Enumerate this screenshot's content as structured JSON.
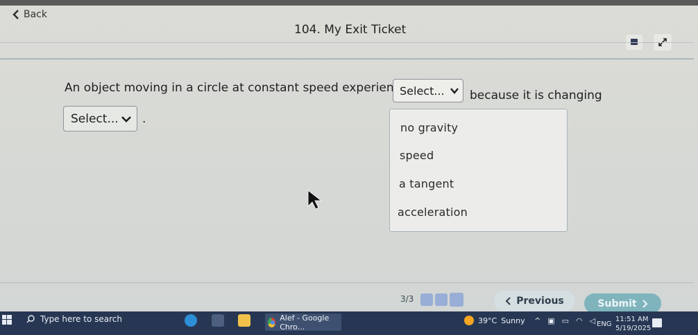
{
  "header": {
    "back_label": "Back",
    "title": "104. My Exit Ticket"
  },
  "question": {
    "text_before": "An object moving in a circle at constant speed experiences",
    "select1_value": "Select...",
    "text_after": "because it is changing",
    "select2_value": "Select...",
    "period": "."
  },
  "dropdown": {
    "options": [
      "no gravity",
      "speed",
      "a tangent",
      "acceleration"
    ]
  },
  "footer": {
    "progress": "3/3",
    "previous_label": "Previous",
    "submit_label": "Submit"
  },
  "taskbar": {
    "search_placeholder": "Type here to search",
    "chrome_window_title": "Alef - Google Chro...",
    "weather_temp": "39°C",
    "weather_desc": "Sunny",
    "language": "ENG",
    "time": "11:51 AM",
    "date": "5/19/2025"
  },
  "colors": {
    "accent": "#7fb4bd",
    "progress_dots": "#98aed6",
    "taskbar": "#273753"
  }
}
